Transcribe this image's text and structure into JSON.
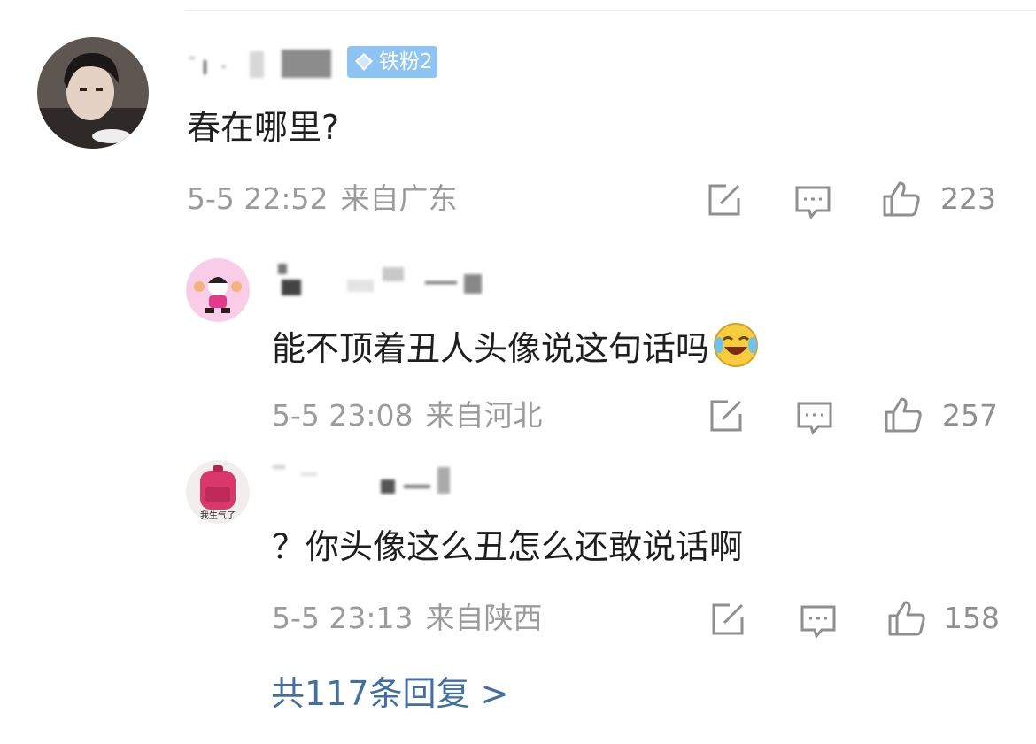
{
  "main_comment": {
    "badge": "铁粉2",
    "text": "春在哪里?",
    "time": "5-5 22:52",
    "location": "来自广东",
    "likes": "223"
  },
  "replies": [
    {
      "text": "能不顶着丑人头像说这句话吗",
      "emoji": "laughing-tears-icon",
      "time": "5-5 23:08",
      "location": "来自河北",
      "likes": "257"
    },
    {
      "text": "？你头像这么丑怎么还敢说话啊",
      "avatar_caption": "我生气了",
      "time": "5-5 23:13",
      "location": "来自陕西",
      "likes": "158"
    }
  ],
  "more_replies": "共117条回复 >",
  "colors": {
    "link": "#3f6fa4",
    "badge": "#8ec4f4",
    "meta": "#9b9b9b"
  },
  "icons": [
    "share-icon",
    "comment-icon",
    "like-icon",
    "diamond-icon"
  ]
}
